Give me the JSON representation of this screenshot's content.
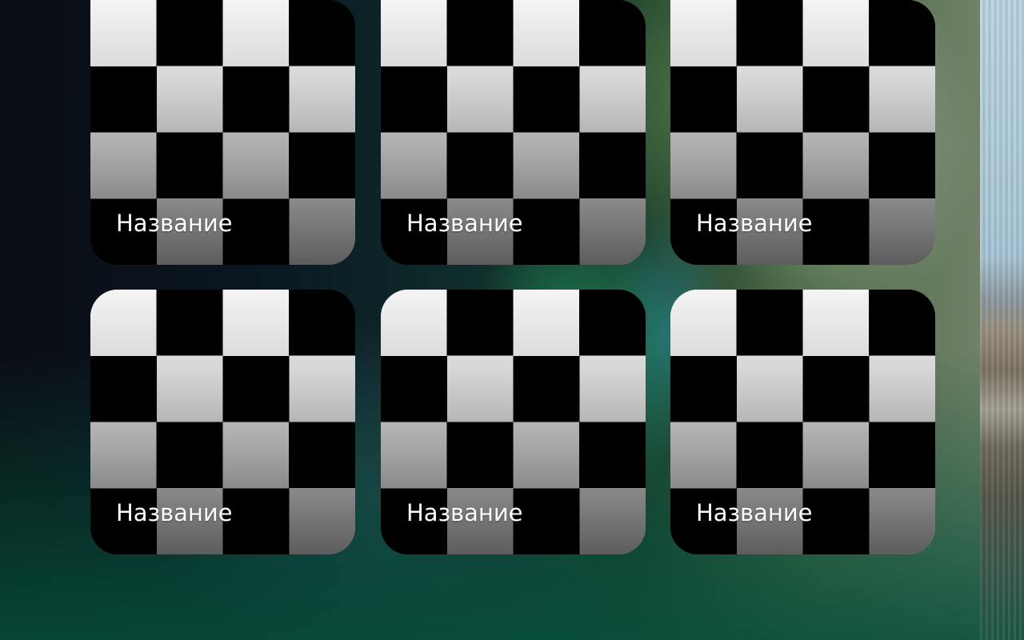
{
  "tiles": [
    {
      "label": "Название",
      "thumbnail": "checkerboard-placeholder"
    },
    {
      "label": "Название",
      "thumbnail": "checkerboard-placeholder"
    },
    {
      "label": "Название",
      "thumbnail": "checkerboard-placeholder"
    },
    {
      "label": "Название",
      "thumbnail": "checkerboard-placeholder"
    },
    {
      "label": "Название",
      "thumbnail": "checkerboard-placeholder"
    },
    {
      "label": "Название",
      "thumbnail": "checkerboard-placeholder"
    }
  ],
  "colors": {
    "label_text": "#ffffff",
    "checker_dark": "#000000",
    "checker_light": "#f4f4f4",
    "wallpaper_green": "#0b5a46"
  }
}
